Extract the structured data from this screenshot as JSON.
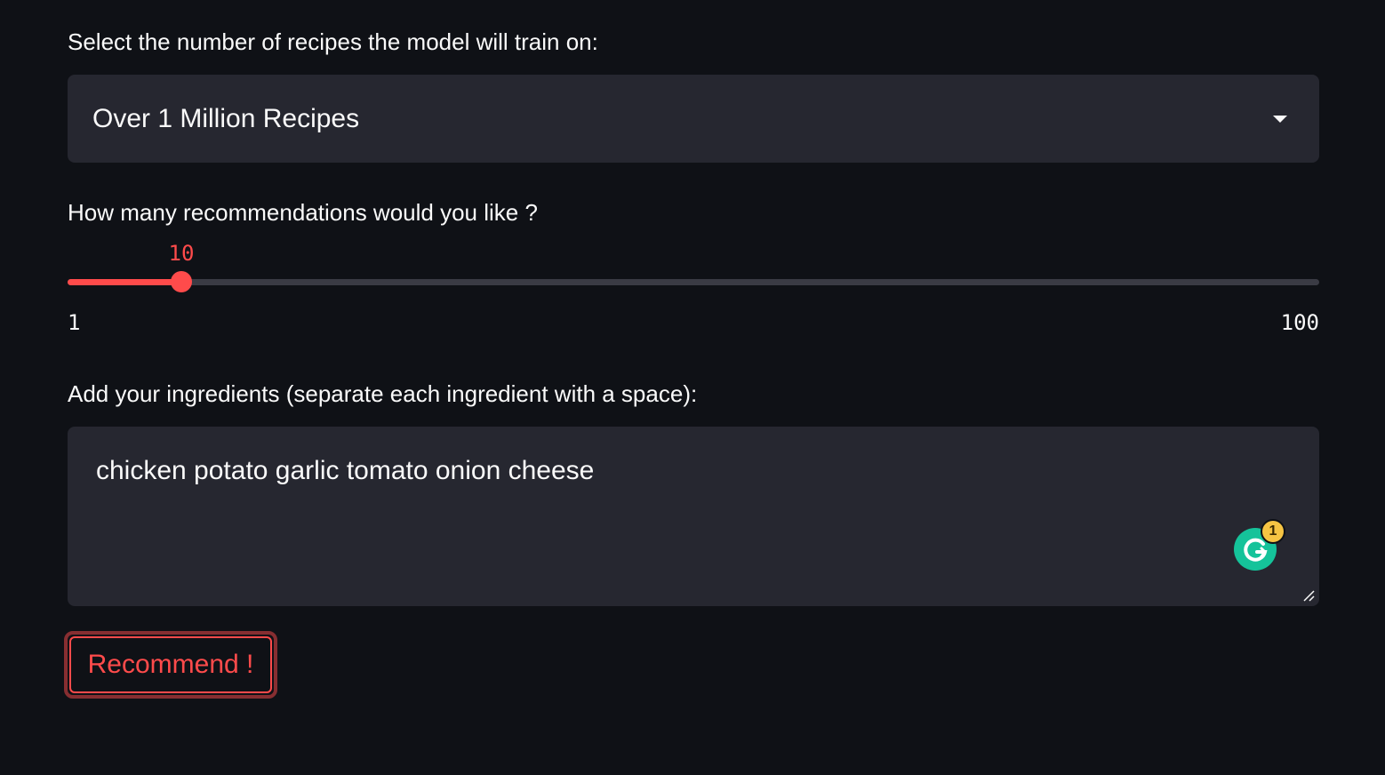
{
  "model_select": {
    "label": "Select the number of recipes the model will train on:",
    "value": "Over 1 Million Recipes"
  },
  "recommendations_slider": {
    "label": "How many recommendations would you like ?",
    "value": 10,
    "min": 1,
    "max": 100,
    "value_text": "10",
    "min_text": "1",
    "max_text": "100",
    "accent_color": "#ff4b4b"
  },
  "ingredients": {
    "label": "Add your ingredients (separate each ingredient with a space):",
    "value": "chicken potato garlic tomato onion cheese"
  },
  "grammarly": {
    "icon": "grammarly-icon",
    "badge_count": "1"
  },
  "recommend_button": {
    "label": "Recommend !"
  }
}
